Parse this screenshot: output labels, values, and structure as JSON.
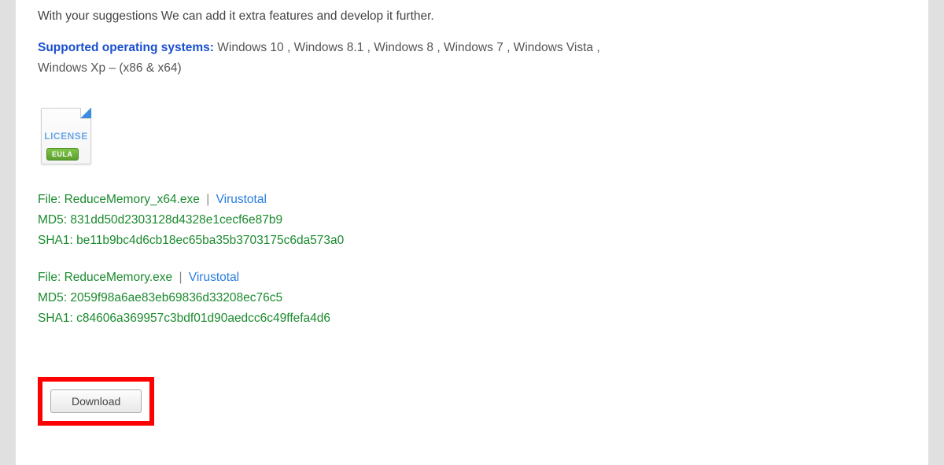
{
  "intro": "With your suggestions We can add it extra features and develop it further.",
  "supported": {
    "label": "Supported operating systems:",
    "list": " Windows 10 , Windows 8.1 , Windows 8 , Windows 7 , Windows Vista , Windows Xp – (x86 & x64)"
  },
  "license": {
    "text": "LICENSE",
    "badge": "EULA"
  },
  "files": [
    {
      "file_label": "File: ReduceMemory_x64.exe",
      "virustotal": "Virustotal",
      "md5": "MD5: 831dd50d2303128d4328e1cecf6e87b9",
      "sha1": "SHA1: be11b9bc4d6cb18ec65ba35b3703175c6da573a0"
    },
    {
      "file_label": "File: ReduceMemory.exe",
      "virustotal": "Virustotal",
      "md5": "MD5: 2059f98a6ae83eb69836d33208ec76c5",
      "sha1": "SHA1: c84606a369957c3bdf01d90aedcc6c49ffefa4d6"
    }
  ],
  "download_label": "Download"
}
